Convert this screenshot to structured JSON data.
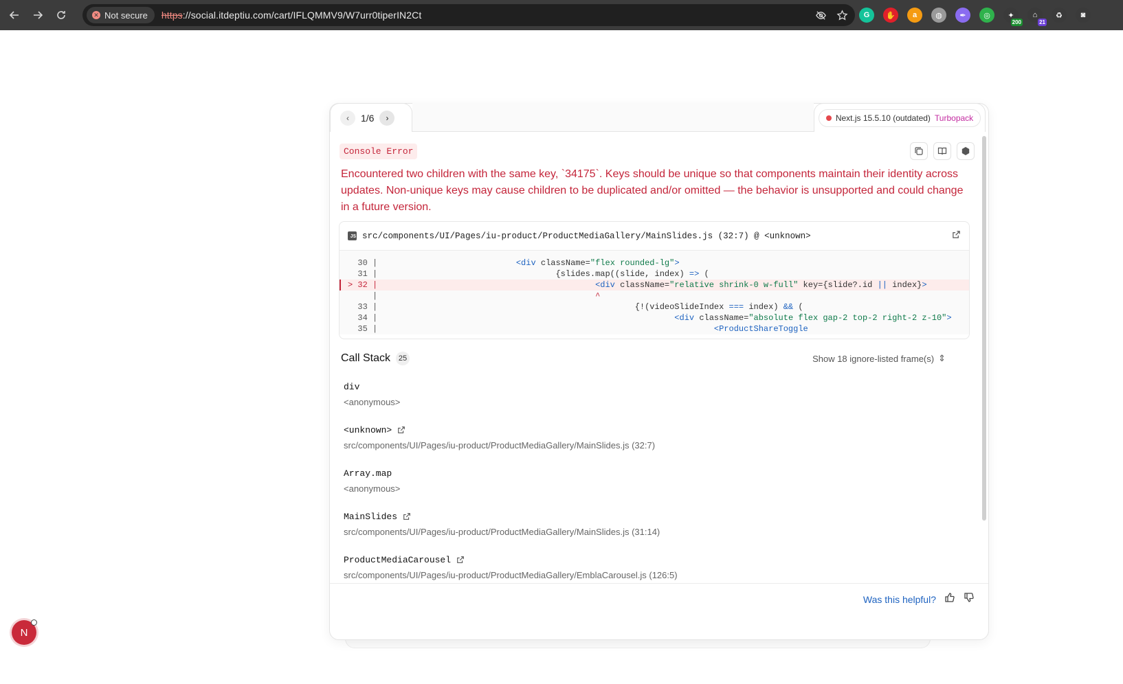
{
  "browser": {
    "security_label": "Not secure",
    "url_scheme": "https",
    "url_rest": "://social.itdeptiu.com/cart/IFLQMMV9/W7urr0tiperIN2Ct",
    "extensions": [
      {
        "name": "grammarly-icon",
        "glyph": "G",
        "color": "#15c39a"
      },
      {
        "name": "adblock-icon",
        "glyph": "✋",
        "color": "#e0202a"
      },
      {
        "name": "amazon-icon",
        "glyph": "a",
        "color": "#f59b12"
      },
      {
        "name": "globe-icon",
        "glyph": "◍",
        "color": "#9a9a9a"
      },
      {
        "name": "feather-icon",
        "glyph": "✒",
        "color": "#8a6cf0"
      },
      {
        "name": "target-icon",
        "glyph": "◎",
        "color": "#2fb24c"
      },
      {
        "name": "counter-200-icon",
        "glyph": "✦",
        "color": "#3a3a3a",
        "badge": "200"
      },
      {
        "name": "counter-21-icon",
        "glyph": "⌂",
        "color": "#3a3a3a",
        "badge": "21"
      },
      {
        "name": "recycle-icon",
        "glyph": "♻",
        "color": "#3a3a3a"
      },
      {
        "name": "camera-icon",
        "glyph": "◙",
        "color": "#3a3a3a"
      }
    ]
  },
  "overlay": {
    "pager": "1/6",
    "next_version": "Next.js 15.5.10 (outdated)",
    "bundler": "Turbopack",
    "badge": "Console Error",
    "message": "Encountered two children with the same key, `34175`. Keys should be unique so that components maintain their identity across updates. Non-unique keys may cause children to be duplicated and/or omitted — the behavior is unsupported and could change in a future version.",
    "code_file": "src/components/UI/Pages/iu-product/ProductMediaGallery/MainSlides.js (32:7) @ <unknown>",
    "code_lines": [
      {
        "prefix": "  30 |",
        "indent": "                            ",
        "parts": [
          [
            "tag",
            "<div "
          ],
          [
            "",
            "className="
          ],
          [
            "str",
            "\"flex rounded-lg\""
          ],
          [
            "tag",
            ">"
          ]
        ],
        "hl": false
      },
      {
        "prefix": "  31 |",
        "indent": "                                    ",
        "parts": [
          [
            "",
            "{slides.map((slide, index) "
          ],
          [
            "tag",
            "=>"
          ],
          [
            "",
            " ("
          ]
        ],
        "hl": false
      },
      {
        "prefix": "> 32 |",
        "indent": "                                            ",
        "parts": [
          [
            "tag",
            "<div "
          ],
          [
            "",
            "className="
          ],
          [
            "str",
            "\"relative shrink-0 w-full\""
          ],
          [
            "",
            " key={slide?.id "
          ],
          [
            "tag",
            "||"
          ],
          [
            "",
            " index}"
          ],
          [
            "tag",
            ">"
          ]
        ],
        "hl": true
      },
      {
        "prefix": "     |",
        "indent": "                                            ",
        "parts": [
          [
            "caret",
            "^"
          ]
        ],
        "hl": false
      },
      {
        "prefix": "  33 |",
        "indent": "                                                    ",
        "parts": [
          [
            "",
            "{!(videoSlideIndex "
          ],
          [
            "tag",
            "==="
          ],
          [
            "",
            " index) "
          ],
          [
            "tag",
            "&&"
          ],
          [
            "",
            " ("
          ]
        ],
        "hl": false
      },
      {
        "prefix": "  34 |",
        "indent": "                                                            ",
        "parts": [
          [
            "tag",
            "<div "
          ],
          [
            "",
            "className="
          ],
          [
            "str",
            "\"absolute flex gap-2 top-2 right-2 z-10\""
          ],
          [
            "tag",
            ">"
          ]
        ],
        "hl": false
      },
      {
        "prefix": "  35 |",
        "indent": "                                                                    ",
        "parts": [
          [
            "tag",
            "<ProductShareToggle"
          ]
        ],
        "hl": false
      }
    ],
    "call_stack_title": "Call Stack",
    "call_stack_count": "25",
    "ignore_toggle": "Show 18 ignore-listed frame(s)",
    "frames": [
      {
        "name": "div",
        "loc": "<anonymous>",
        "link": false
      },
      {
        "name": "<unknown>",
        "loc": "src/components/UI/Pages/iu-product/ProductMediaGallery/MainSlides.js (32:7)",
        "link": true
      },
      {
        "name": "Array.map",
        "loc": "<anonymous>",
        "link": false
      },
      {
        "name": "MainSlides",
        "loc": "src/components/UI/Pages/iu-product/ProductMediaGallery/MainSlides.js (31:14)",
        "link": true
      },
      {
        "name": "ProductMediaCarousel",
        "loc": "src/components/UI/Pages/iu-product/ProductMediaGallery/EmblaCarousel.js (126:5)",
        "link": true
      }
    ],
    "helpful_label": "Was this helpful?"
  },
  "dev_badge": "N"
}
